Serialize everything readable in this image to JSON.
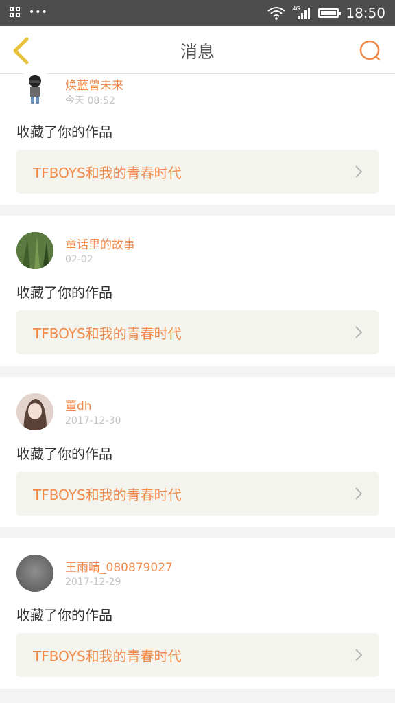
{
  "status_bar": {
    "time": "18:50",
    "network": "4G"
  },
  "header": {
    "title": "消息"
  },
  "messages": [
    {
      "user": "焕蓝曾未来",
      "time": "今天 08:52",
      "action": "收藏了你的作品",
      "work_title": "TFBOYS和我的青春时代"
    },
    {
      "user": "童话里的故事",
      "time": "02-02",
      "action": "收藏了你的作品",
      "work_title": "TFBOYS和我的青春时代"
    },
    {
      "user": "董dh",
      "time": "2017-12-30",
      "action": "收藏了你的作品",
      "work_title": "TFBOYS和我的青春时代"
    },
    {
      "user": "王雨晴_080879027",
      "time": "2017-12-29",
      "action": "收藏了你的作品",
      "work_title": "TFBOYS和我的青春时代"
    }
  ],
  "colors": {
    "accent": "#f08a4b",
    "status_bar_bg": "#4d4d4d",
    "link_bg": "#f4f4ee"
  }
}
